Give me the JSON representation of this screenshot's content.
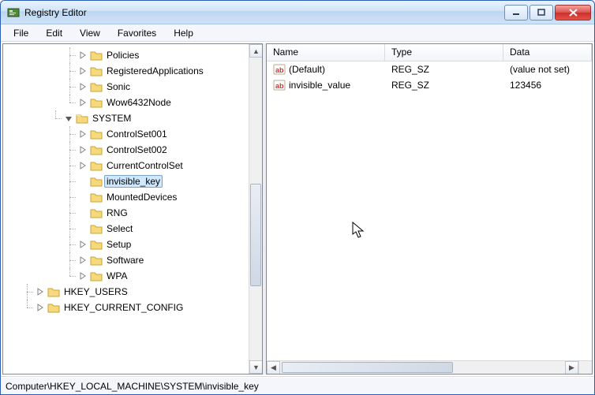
{
  "window": {
    "title": "Registry Editor"
  },
  "menu": {
    "file": "File",
    "edit": "Edit",
    "view": "View",
    "favorites": "Favorites",
    "help": "Help"
  },
  "tree": {
    "software_children": [
      "Policies",
      "RegisteredApplications",
      "Sonic",
      "Wow6432Node"
    ],
    "system_label": "SYSTEM",
    "system_children": [
      "ControlSet001",
      "ControlSet002",
      "CurrentControlSet",
      "invisible_key",
      "MountedDevices",
      "RNG",
      "Select",
      "Setup",
      "Software",
      "WPA"
    ],
    "selected": "invisible_key",
    "hkey_users": "HKEY_USERS",
    "hkey_current_config": "HKEY_CURRENT_CONFIG"
  },
  "list": {
    "header": {
      "name": "Name",
      "type": "Type",
      "data": "Data"
    },
    "rows": [
      {
        "name": "(Default)",
        "type": "REG_SZ",
        "data": "(value not set)"
      },
      {
        "name": "invisible_value",
        "type": "REG_SZ",
        "data": "123456"
      }
    ]
  },
  "statusbar": {
    "path": "Computer\\HKEY_LOCAL_MACHINE\\SYSTEM\\invisible_key"
  }
}
